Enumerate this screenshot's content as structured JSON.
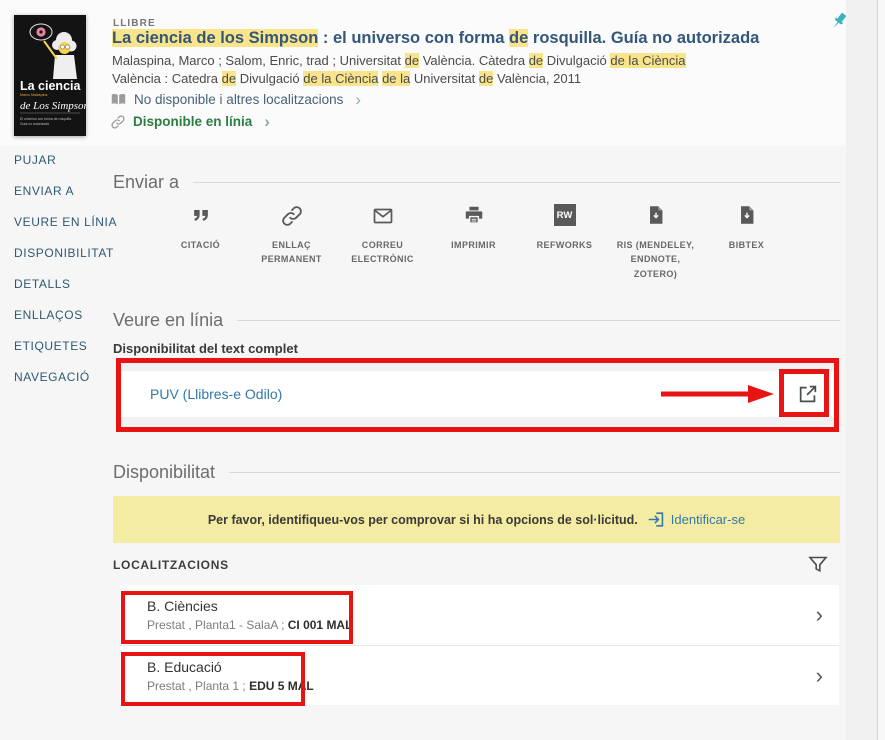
{
  "icons": {
    "chevron_right": "›"
  },
  "header": {
    "doc_type": "LLIBRE",
    "title_segments": [
      {
        "t": "La ciencia de los Simpson",
        "c": "hl"
      },
      {
        "t": " : el universo con forma "
      },
      {
        "t": "de",
        "c": "hl"
      },
      {
        "t": " rosquilla. Guía no autorizada"
      }
    ],
    "byline_segments": [
      {
        "t": "Malaspina, Marco ; Salom, Enric, trad ; Universitat "
      },
      {
        "t": "de",
        "c": "hl"
      },
      {
        "t": " València. Càtedra "
      },
      {
        "t": "de",
        "c": "hl"
      },
      {
        "t": " Divulgació "
      },
      {
        "t": "de la Ciència",
        "c": "hl"
      }
    ],
    "pub_segments": [
      {
        "t": "València : Catedra "
      },
      {
        "t": "de",
        "c": "hl"
      },
      {
        "t": " Divulgació "
      },
      {
        "t": "de la Ciència",
        "c": "hl"
      },
      {
        "t": " "
      },
      {
        "t": "de la",
        "c": "hl"
      },
      {
        "t": " Universitat "
      },
      {
        "t": "de",
        "c": "hl"
      },
      {
        "t": " València, 2011"
      }
    ],
    "availability_physical": "No disponible i altres localitzacions",
    "availability_online": "Disponible en línia"
  },
  "cover": {
    "author": "Marco Malaspina",
    "title1": "La ciencia",
    "title2": "de Los Simpson",
    "subtitle1": "El universo con forma de rosquilla.",
    "subtitle2": "Guía no autorizada"
  },
  "sidebar": {
    "items": [
      {
        "label": "PUJAR"
      },
      {
        "label": "ENVIAR A"
      },
      {
        "label": "VEURE EN LÍNIA"
      },
      {
        "label": "DISPONIBILITAT"
      },
      {
        "label": "DETALLS"
      },
      {
        "label": "ENLLAÇOS"
      },
      {
        "label": "ETIQUETES"
      },
      {
        "label": "NAVEGACIÓ"
      }
    ]
  },
  "send_to": {
    "heading": "Enviar a",
    "actions": [
      {
        "label": "CITACIÓ",
        "icon": "quote-icon"
      },
      {
        "label": "ENLLAÇ PERMANENT",
        "icon": "link-icon"
      },
      {
        "label": "CORREU ELECTRÒNIC",
        "icon": "envelope-icon"
      },
      {
        "label": "IMPRIMIR",
        "icon": "printer-icon"
      },
      {
        "label": "REFWORKS",
        "icon": "refworks-badge",
        "badge_text": "RW"
      },
      {
        "label": "RIS (MENDELEY, ENDNOTE, ZOTERO)",
        "icon": "document-export-icon"
      },
      {
        "label": "BIBTEX",
        "icon": "document-export-icon"
      }
    ]
  },
  "view_online": {
    "heading": "Veure en línia",
    "subheading": "Disponibilitat del text complet",
    "provider_link": "PUV (Llibres-e Odilo)"
  },
  "availability_section": {
    "heading": "Disponibilitat",
    "banner_text": "Per favor, identifiqueu-vos per comprovar si hi ha opcions de sol·licitud.",
    "signin_label": "Identificar-se"
  },
  "locations": {
    "heading": "LOCALITZACIONS",
    "items": [
      {
        "name": "B. Ciències",
        "details_segments": [
          {
            "t": "Prestat , Planta1 - SalaA ; "
          },
          {
            "t": "CI 001 MAL",
            "c": "b"
          }
        ]
      },
      {
        "name": "B. Educació",
        "details_segments": [
          {
            "t": "Prestat , Planta 1 ; "
          },
          {
            "t": "EDU 5 MAL",
            "c": "b"
          }
        ]
      }
    ]
  },
  "colors": {
    "annotation_red": "#e81313",
    "pin_teal": "#3ab3bc",
    "link_blue": "#3477a9",
    "online_green": "#2d7d43",
    "highlight_yellow": "#f8e48a",
    "banner_yellow": "#f5eca4"
  }
}
